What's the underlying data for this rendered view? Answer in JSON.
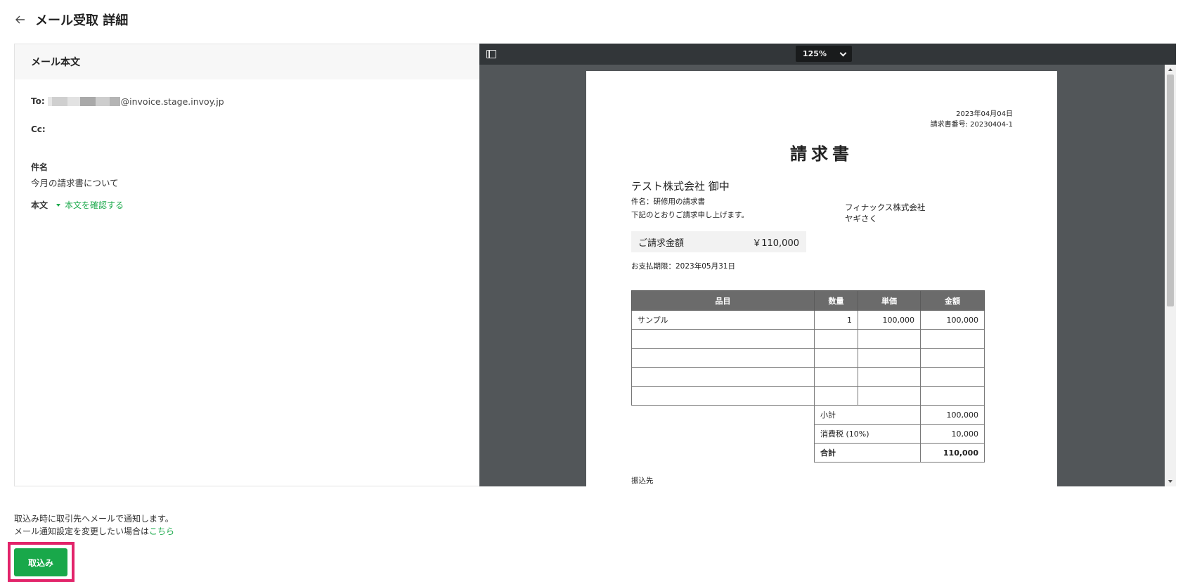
{
  "header": {
    "title": "メール受取 詳細"
  },
  "mail": {
    "panel_title": "メール本文",
    "to_label": "To:",
    "to_address_visible": "@invoice.stage.invoy.jp",
    "cc_label": "Cc:",
    "subject_label": "件名",
    "subject_value": "今月の請求書について",
    "body_label": "本文",
    "body_toggle": "本文を確認する"
  },
  "pdf_viewer": {
    "zoom": "125%",
    "document": {
      "date": "2023年04月04日",
      "invoice_number": "請求書番号: 20230404-1",
      "title": "請求書",
      "recipient": "テスト株式会社 御中",
      "subject": "件名：研修用の請求書",
      "intro": "下記のとおりご請求申し上げます。",
      "issuer_name": "フィナックス株式会社",
      "issuer_person": "ヤギさく",
      "amount_label": "ご請求金額",
      "amount_value": "￥110,000",
      "due_date": "お支払期限：2023年05月31日",
      "table": {
        "headers": [
          "品目",
          "数量",
          "単価",
          "金額"
        ],
        "rows": [
          [
            "サンプル",
            "1",
            "100,000",
            "100,000"
          ],
          [
            "",
            "",
            "",
            ""
          ],
          [
            "",
            "",
            "",
            ""
          ],
          [
            "",
            "",
            "",
            ""
          ],
          [
            "",
            "",
            "",
            ""
          ]
        ],
        "subtotal_label": "小計",
        "subtotal_value": "100,000",
        "tax_label": "消費税 (10%)",
        "tax_value": "10,000",
        "total_label": "合計",
        "total_value": "110,000"
      },
      "transfer_label": "振込先"
    }
  },
  "footer": {
    "notice_line1": "取込み時に取引先へメールで通知します。",
    "notice_line2_prefix": "メール通知設定を変更したい場合は",
    "notice_link": "こちら",
    "import_button": "取込み"
  },
  "colors": {
    "accent_green": "#19a84a",
    "highlight_pink": "#e2246a",
    "pdf_background": "#525659",
    "pdf_toolbar": "#323639"
  }
}
